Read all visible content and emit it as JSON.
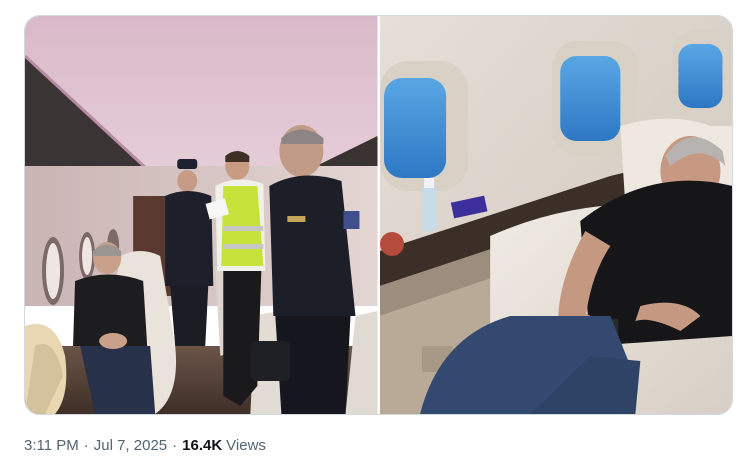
{
  "tweet": {
    "time": "3:11 PM",
    "separator": "·",
    "date": "Jul 7, 2025",
    "views_count": "16.4K",
    "views_label": "Views"
  },
  "media": {
    "photos": [
      {
        "description": "photo-1"
      },
      {
        "description": "photo-2"
      }
    ]
  }
}
